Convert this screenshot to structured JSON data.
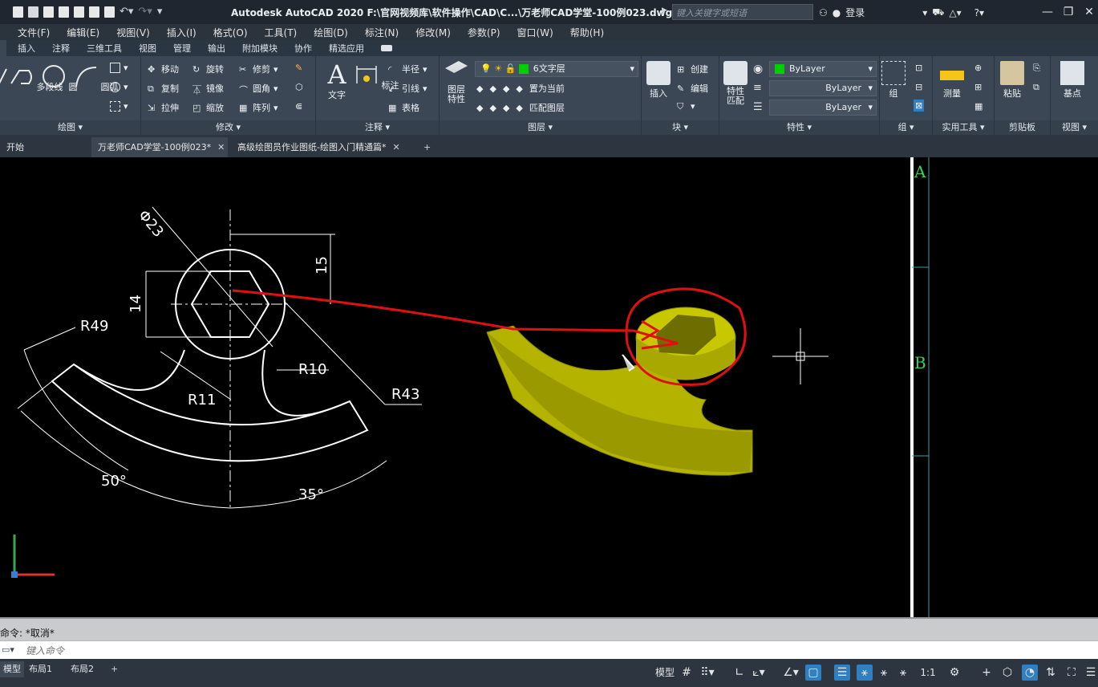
{
  "titlebar": {
    "app_title": "Autodesk AutoCAD 2020    F:\\官网视频库\\软件操作\\CAD\\C...\\万老师CAD学堂-100例023.dwg",
    "search_placeholder": "键入关键字或短语",
    "login": "登录"
  },
  "menubar": [
    "文件(F)",
    "编辑(E)",
    "视图(V)",
    "插入(I)",
    "格式(O)",
    "工具(T)",
    "绘图(D)",
    "标注(N)",
    "修改(M)",
    "参数(P)",
    "窗口(W)",
    "帮助(H)"
  ],
  "ribbon_tabs": [
    "插入",
    "注释",
    "三维工具",
    "视图",
    "管理",
    "输出",
    "附加模块",
    "协作",
    "精选应用"
  ],
  "ribbon": {
    "draw": {
      "title": "绘图",
      "polyline": "多段线",
      "circle": "圆",
      "arc": "圆弧"
    },
    "modify": {
      "title": "修改",
      "move": "移动",
      "rotate": "旋转",
      "trim": "修剪",
      "copy": "复制",
      "mirror": "镜像",
      "fillet": "圆角",
      "stretch": "拉伸",
      "scale": "缩放",
      "array": "阵列"
    },
    "annotation": {
      "title": "注释",
      "text": "文字",
      "dimension": "标注",
      "radius": "半径",
      "leader": "引线",
      "table": "表格"
    },
    "layers": {
      "title": "图层",
      "properties": "图层\n特性",
      "current_layer": "6文字层",
      "set_current": "置为当前",
      "match_layer": "匹配图层"
    },
    "block": {
      "title": "块",
      "insert": "插入",
      "create": "创建",
      "edit": "编辑"
    },
    "properties": {
      "title": "特性",
      "match": "特性\n匹配",
      "color": "ByLayer",
      "linetype": "ByLayer",
      "lineweight": "ByLayer"
    },
    "groups": {
      "title": "组",
      "group": "组"
    },
    "utilities": {
      "title": "实用工具",
      "measure": "测量"
    },
    "clipboard": {
      "title": "剪贴板",
      "paste": "粘贴"
    },
    "view": {
      "title": "视图",
      "base": "基点"
    }
  },
  "doc_tabs": [
    "开始",
    "万老师CAD学堂-100例023*",
    "高级绘图员作业图纸-绘图入门精通篇*"
  ],
  "drawing": {
    "dims": [
      "Φ23",
      "15",
      "14",
      "R49",
      "R10",
      "R11",
      "R43",
      "50°",
      "35°"
    ],
    "grid_labels": [
      "A",
      "B"
    ],
    "colors": {
      "background": "#000000",
      "lines": "#ffffff",
      "solid": "#c8c800",
      "markup": "#e01010",
      "grid": "#39d353"
    }
  },
  "command": {
    "history": "命令: *取消*",
    "input_placeholder": "键入命令"
  },
  "statusbar": {
    "layout_tabs": [
      "模型",
      "布局1",
      "布局2"
    ],
    "model_label": "模型",
    "scale": "1:1"
  }
}
